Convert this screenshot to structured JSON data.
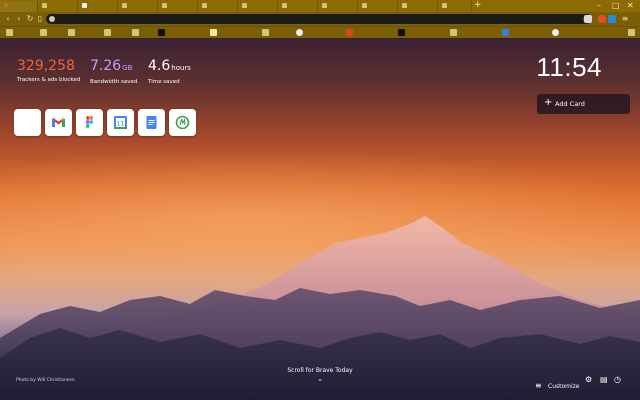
{
  "browser": {
    "new_tab_symbol": "+",
    "minimize": "–",
    "maximize": "□",
    "close": "✕",
    "tab_close": "✕",
    "accent": "#8c6a04",
    "omnibox": {
      "value": "",
      "placeholder": ""
    },
    "bookmark_star": "☆"
  },
  "stats": {
    "trackers": {
      "value": "329,258",
      "label": "Trackers & ads blocked",
      "color": "#f0643c"
    },
    "bandwidth": {
      "value": "7.26",
      "unit": "GB",
      "label": "Bandwidth saved",
      "color": "#b8a6ff"
    },
    "time": {
      "value": "4.6",
      "unit": "hours",
      "label": "Time saved",
      "color": "#ffffff"
    }
  },
  "clock": {
    "time": "11:54"
  },
  "add_card": {
    "label": "Add Card"
  },
  "top_sites": [
    {
      "name": "blank",
      "icon": "blank-tile-icon"
    },
    {
      "name": "Gmail",
      "icon": "gmail-icon"
    },
    {
      "name": "Figma",
      "icon": "figma-icon"
    },
    {
      "name": "Google Calendar",
      "icon": "calendar-icon",
      "text": "11"
    },
    {
      "name": "Google Docs",
      "icon": "docs-icon"
    },
    {
      "name": "Green site",
      "icon": "green-circle-icon"
    }
  ],
  "footer": {
    "credit": "Photo by Will Christiansen",
    "scroll": "Scroll for Brave Today",
    "customize": "Customize"
  }
}
